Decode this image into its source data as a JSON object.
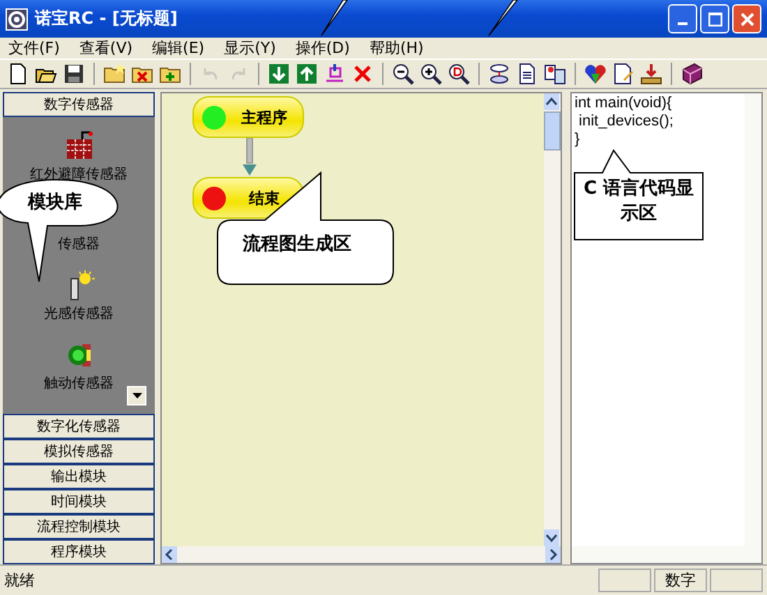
{
  "window": {
    "title": "诺宝RC - [无标题]"
  },
  "menu": [
    {
      "label": "文件(F)"
    },
    {
      "label": "查看(V)"
    },
    {
      "label": "编辑(E)"
    },
    {
      "label": "显示(Y)"
    },
    {
      "label": "操作(D)"
    },
    {
      "label": "帮助(H)"
    }
  ],
  "toolbar": [
    {
      "kind": "new"
    },
    {
      "kind": "open"
    },
    {
      "kind": "save"
    },
    {
      "kind": "sep"
    },
    {
      "kind": "folder-star"
    },
    {
      "kind": "folder-x"
    },
    {
      "kind": "folder-plus"
    },
    {
      "kind": "sep"
    },
    {
      "kind": "undo",
      "disabled": true
    },
    {
      "kind": "redo",
      "disabled": true
    },
    {
      "kind": "sep"
    },
    {
      "kind": "down"
    },
    {
      "kind": "up"
    },
    {
      "kind": "insert"
    },
    {
      "kind": "delete"
    },
    {
      "kind": "sep"
    },
    {
      "kind": "zoom-out"
    },
    {
      "kind": "zoom-in"
    },
    {
      "kind": "zoom-fit"
    },
    {
      "kind": "sep"
    },
    {
      "kind": "flow"
    },
    {
      "kind": "doc"
    },
    {
      "kind": "compare"
    },
    {
      "kind": "sep"
    },
    {
      "kind": "heart"
    },
    {
      "kind": "edit"
    },
    {
      "kind": "download"
    },
    {
      "kind": "sep"
    },
    {
      "kind": "book"
    }
  ],
  "sidebar": {
    "open_section": "数字传感器",
    "items": [
      {
        "label": "红外避障传感器",
        "kind": "ir"
      },
      {
        "label": "传感器",
        "kind": "covered"
      },
      {
        "label": "光感传感器",
        "kind": "light"
      },
      {
        "label": "触动传感器",
        "kind": "touch"
      }
    ],
    "sections": [
      {
        "label": "数字化传感器"
      },
      {
        "label": "模拟传感器"
      },
      {
        "label": "输出模块"
      },
      {
        "label": "时间模块"
      },
      {
        "label": "流程控制模块"
      },
      {
        "label": "程序模块"
      }
    ]
  },
  "flowchart": {
    "nodes": [
      {
        "label": "主程序",
        "color": "#22ee22"
      },
      {
        "label": "结束",
        "color": "#ee1111"
      }
    ]
  },
  "code": {
    "lines": [
      "int main(void){",
      " init_devices();",
      "}"
    ]
  },
  "callouts": [
    {
      "text": "模块库"
    },
    {
      "text": "流程图生成区"
    },
    {
      "text": "C 语言代码显示区"
    }
  ],
  "status_bar": {
    "text": "就绪",
    "indicator": "数字"
  }
}
